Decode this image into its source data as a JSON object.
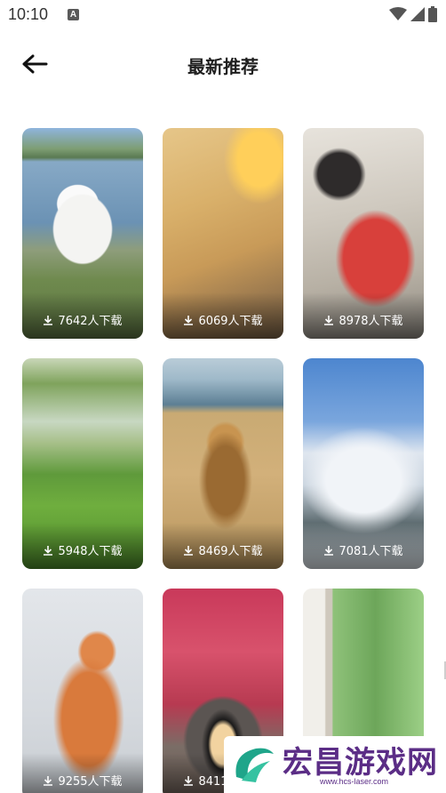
{
  "status_bar": {
    "time": "10:10",
    "notification_letter": "A",
    "icons": [
      "wifi-icon",
      "signal-icon",
      "battery-icon"
    ]
  },
  "header": {
    "back_icon": "arrow-left-icon",
    "title": "最新推荐"
  },
  "wallpapers": [
    {
      "subject": "white poodle by a lake",
      "downloads": "7642人下载"
    },
    {
      "subject": "sunlit building wall",
      "downloads": "6069人下载"
    },
    {
      "subject": "anime boy in red shirt",
      "downloads": "8978人下载"
    },
    {
      "subject": "misty green hills",
      "downloads": "5948人下载"
    },
    {
      "subject": "lion in golden grass",
      "downloads": "8469人下载"
    },
    {
      "subject": "snowy mountain peak",
      "downloads": "7081人下载"
    },
    {
      "subject": "illustrated fox in snow",
      "downloads": "9255人下载"
    },
    {
      "subject": "red trees over tunnel",
      "downloads": "8411人下载"
    },
    {
      "subject": "window with green plants",
      "downloads": ""
    }
  ],
  "download_icon": "download-icon",
  "watermark": {
    "title": "宏昌游戏网",
    "url": "www.hcs-laser.com"
  },
  "colors": {
    "background": "#ffffff",
    "title_text": "#1e1e1e",
    "watermark": "#5b2d86",
    "watermark_logo": "#1fa58a"
  }
}
